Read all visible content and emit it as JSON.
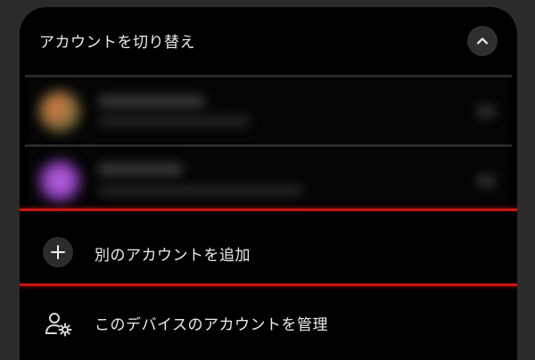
{
  "header": {
    "title": "アカウントを切り替え",
    "collapse_icon": "chevron-up-icon"
  },
  "accounts": {
    "count_visible": 2,
    "note_blurred": true,
    "avatar_colors": [
      "#d86a3a",
      "#b35ce0"
    ]
  },
  "actions": {
    "add_account_label": "別のアカウントを追加",
    "add_account_icon": "plus-icon",
    "manage_accounts_label": "このデバイスのアカウントを管理",
    "manage_accounts_icon": "manage-accounts-icon"
  },
  "colors": {
    "background": "#000000",
    "text": "#ececec",
    "highlight": "#c81414"
  }
}
